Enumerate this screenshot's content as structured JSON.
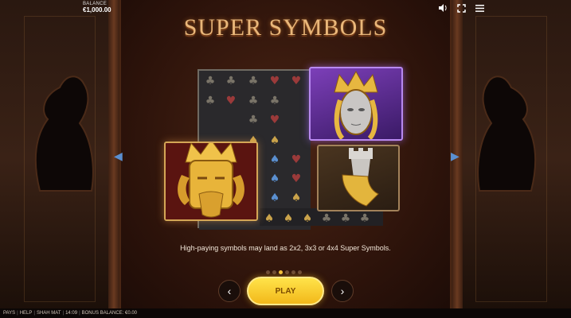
{
  "topbar": {
    "balance_label": "BALANCE",
    "balance_value": "€1,000.00",
    "icons": [
      "sound-icon",
      "fullscreen-icon",
      "menu-icon"
    ]
  },
  "title": "SUPER SYMBOLS",
  "symbols": {
    "small_suits": [
      "club",
      "heart",
      "spade"
    ],
    "big_symbols": [
      "queen",
      "king",
      "rook"
    ]
  },
  "description": "High-paying symbols may land as 2x2, 3x3 or 4x4 Super Symbols.",
  "pagination": {
    "total": 6,
    "active": 3
  },
  "buttons": {
    "play_label": "PLAY",
    "prev_icon": "chevron-left-icon",
    "next_icon": "chevron-right-icon"
  },
  "bottombar": {
    "items": [
      "PAYS",
      "HELP",
      "SHAH MAT",
      "14:09",
      "BONUS BALANCE: €0.00"
    ]
  },
  "colors": {
    "accent": "#f4c13b",
    "title": "#e9b77a",
    "queen_frame": "#b889f0"
  }
}
